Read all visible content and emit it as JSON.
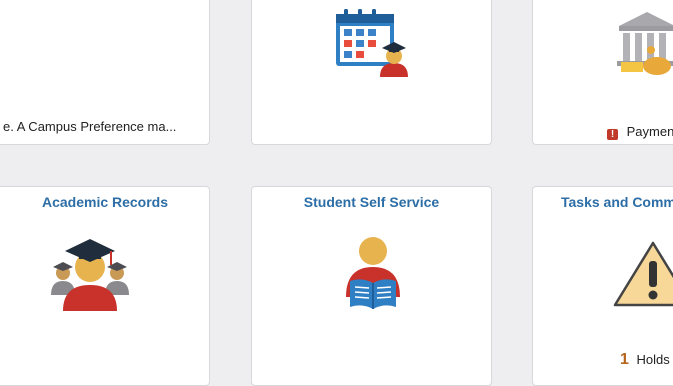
{
  "tiles": {
    "top_left": {
      "footer_text": "e.  A Campus Preference ma..."
    },
    "top_middle": {
      "icon": "calendar-graduate-icon"
    },
    "top_right": {
      "icon": "bank-payment-icon",
      "footer_text": "Paymen"
    },
    "academic_records": {
      "title": "Academic Records",
      "icon": "graduates-icon"
    },
    "student_self_service": {
      "title": "Student Self Service",
      "icon": "student-reading-icon"
    },
    "tasks": {
      "title": "Tasks and Comm",
      "icon": "warning-icon",
      "count": "1",
      "count_label": "Holds"
    }
  },
  "colors": {
    "title_blue": "#2d6ea6",
    "alert_red": "#c0392b",
    "count_brown": "#b5651d"
  }
}
